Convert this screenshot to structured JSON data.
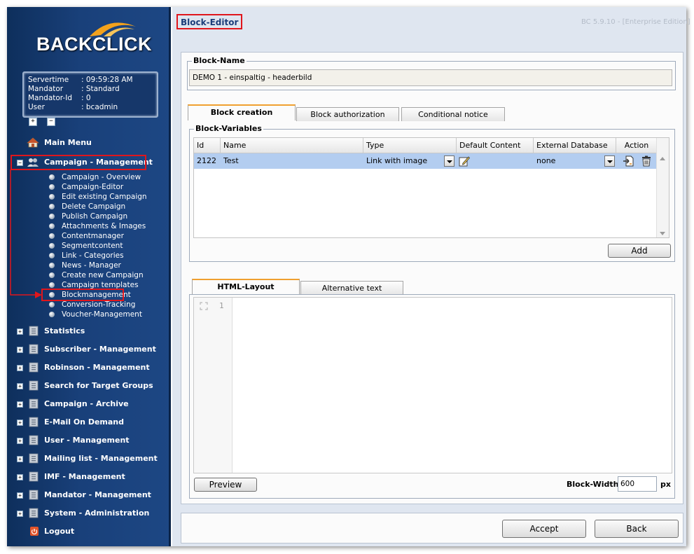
{
  "app": {
    "logo": "BACKCLICK",
    "page_title": "Block-Editor",
    "version": "BC 5.9.10 - [Enterprise Edition]"
  },
  "info": [
    {
      "key": "Servertime",
      "value": ": 09:59:28 AM"
    },
    {
      "key": "Mandator",
      "value": ": Standard"
    },
    {
      "key": "Mandator-Id",
      "value": ": 0"
    },
    {
      "key": "User",
      "value": ": bcadmin"
    }
  ],
  "controls": {
    "expand": "+",
    "collapse": "−"
  },
  "nav": {
    "main_menu": "Main Menu",
    "campaign": "Campaign - Management",
    "campaign_sub": [
      "Campaign - Overview",
      "Campaign-Editor",
      "Edit existing Campaign",
      "Delete Campaign",
      "Publish Campaign",
      "Attachments & Images",
      "Contentmanager",
      "Segmentcontent",
      "Link - Categories",
      "News - Manager",
      "Create new Campaign",
      "Campaign templates",
      "Blockmanagement",
      "Conversion-Tracking",
      "Voucher-Management"
    ],
    "sections": [
      "Statistics",
      "Subscriber - Management",
      "Robinson - Management",
      "Search for Target Groups",
      "Campaign - Archive",
      "E-Mail On Demand",
      "User - Management",
      "Mailing list - Management",
      "IMF - Management",
      "Mandator - Management",
      "System - Administration"
    ],
    "logout": "Logout"
  },
  "block_name": {
    "legend": "Block-Name",
    "value": "DEMO 1 - einspaltig - headerbild"
  },
  "tabs": [
    "Block creation",
    "Block authorization",
    "Conditional notice"
  ],
  "block_vars": {
    "legend": "Block-Variables",
    "columns": [
      "Id",
      "Name",
      "Type",
      "Default Content",
      "External Database",
      "Action"
    ],
    "rows": [
      {
        "id": "2122",
        "name": "Test",
        "type": "Link with image",
        "db": "none"
      }
    ],
    "add": "Add"
  },
  "layout_tabs": [
    "HTML-Layout",
    "Alternative text"
  ],
  "editor": {
    "line": "1"
  },
  "preview": "Preview",
  "width": {
    "label": "Block-Width:",
    "value": "600",
    "unit": "px"
  },
  "footer": {
    "accept": "Accept",
    "back": "Back"
  },
  "colors": {
    "highlight": "#e0161c",
    "sidebar": "#19407a",
    "row_selected": "#b3cdf0"
  }
}
